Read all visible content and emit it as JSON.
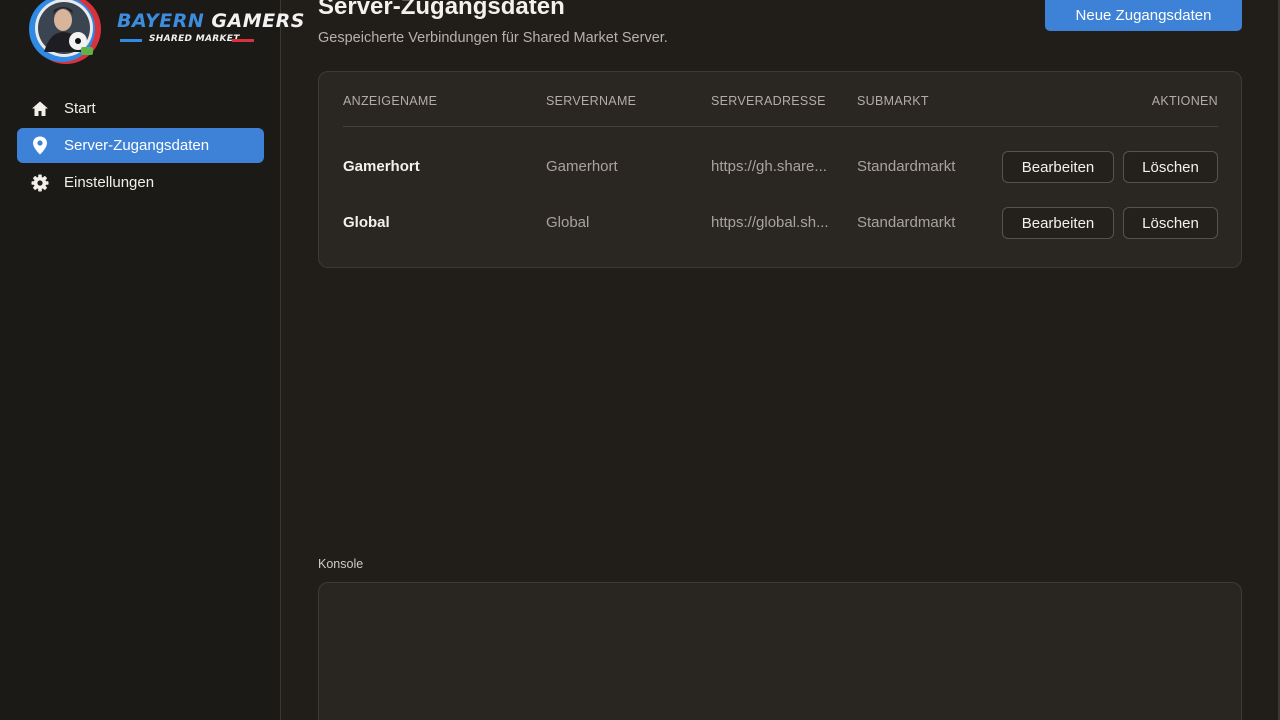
{
  "brand": {
    "title_part1": "BAYERN",
    "title_part2": "GAMERS",
    "subtitle": "SHARED MARKET",
    "accent_blue": "#2f8ae6",
    "accent_red": "#d8323e"
  },
  "sidebar": {
    "items": [
      {
        "label": "Start",
        "icon": "home-icon",
        "active": false
      },
      {
        "label": "Server-Zugangsdaten",
        "icon": "location-pin-icon",
        "active": true
      },
      {
        "label": "Einstellungen",
        "icon": "gear-icon",
        "active": false
      }
    ]
  },
  "header": {
    "title": "Server-Zugangsdaten",
    "subtitle": "Gespeicherte Verbindungen für Shared Market Server.",
    "new_button_label": "Neue Zugangsdaten"
  },
  "table": {
    "columns": [
      "ANZEIGENAME",
      "SERVERNAME",
      "SERVERADRESSE",
      "SUBMARKT",
      "AKTIONEN"
    ],
    "rows": [
      {
        "display_name": "Gamerhort",
        "server_name": "Gamerhort",
        "server_address": "https://gh.share...",
        "submarket": "Standardmarkt",
        "edit_label": "Bearbeiten",
        "delete_label": "Löschen"
      },
      {
        "display_name": "Global",
        "server_name": "Global",
        "server_address": "https://global.sh...",
        "submarket": "Standardmarkt",
        "edit_label": "Bearbeiten",
        "delete_label": "Löschen"
      }
    ]
  },
  "console": {
    "label": "Konsole",
    "content": ""
  },
  "colors": {
    "background": "#211e1a",
    "sidebar_background": "#1c1a17",
    "primary": "#3d82d6",
    "card_background": "#2a2723"
  }
}
